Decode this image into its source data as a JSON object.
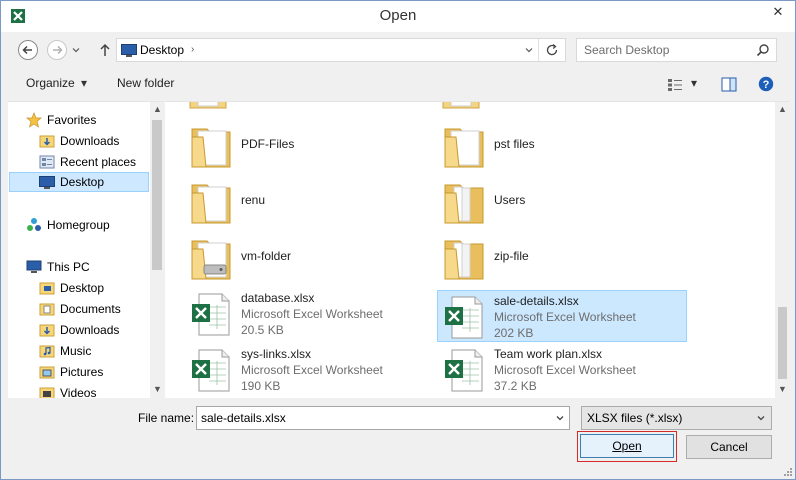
{
  "window": {
    "title": "Open",
    "close_glyph": "✕"
  },
  "address": {
    "location": "Desktop",
    "separator": "›",
    "search_placeholder": "Search Desktop"
  },
  "toolbar": {
    "organize_label": "Organize",
    "organize_arrow": "▾",
    "new_folder_label": "New folder",
    "view_arrow": "▾"
  },
  "nav": {
    "favorites": "Favorites",
    "downloads": "Downloads",
    "recent_places": "Recent places",
    "desktop": "Desktop",
    "homegroup": "Homegroup",
    "this_pc": "This PC",
    "pc_desktop": "Desktop",
    "pc_documents": "Documents",
    "pc_downloads": "Downloads",
    "pc_music": "Music",
    "pc_pictures": "Pictures",
    "pc_videos": "Videos",
    "scroll_up": "▲",
    "scroll_down": "▼"
  },
  "files": {
    "items": [
      {
        "name": "PDF-Files"
      },
      {
        "name": "pst files"
      },
      {
        "name": "renu"
      },
      {
        "name": "Users"
      },
      {
        "name": "vm-folder"
      },
      {
        "name": "zip-file"
      },
      {
        "name": "database.xlsx",
        "type": "Microsoft Excel Worksheet",
        "size": "20.5 KB"
      },
      {
        "name": "sale-details.xlsx",
        "type": "Microsoft Excel Worksheet",
        "size": "202 KB"
      },
      {
        "name": "sys-links.xlsx",
        "type": "Microsoft Excel Worksheet",
        "size": "190 KB"
      },
      {
        "name": "Team work plan.xlsx",
        "type": "Microsoft Excel Worksheet",
        "size": "37.2 KB"
      }
    ],
    "scroll_up": "▲",
    "scroll_down": "▼"
  },
  "bottom": {
    "file_name_label": "File name:",
    "file_name_value": "sale-details.xlsx",
    "filter_value": "XLSX files (*.xlsx)",
    "open_label": "Open",
    "cancel_label": "Cancel"
  },
  "colors": {
    "selection_bg": "#cce8ff",
    "selection_border": "#99d1ff",
    "open_highlight": "#d62b2b",
    "excel_green": "#1e7145"
  }
}
